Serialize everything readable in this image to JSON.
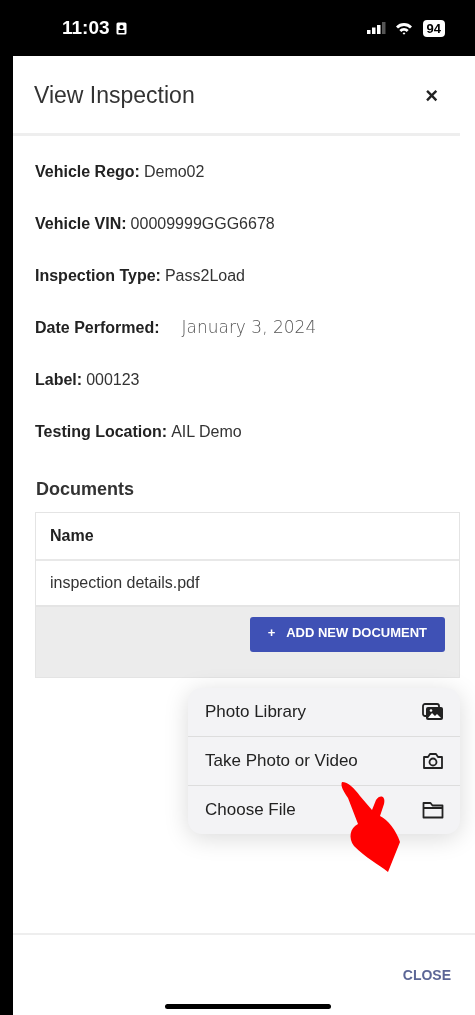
{
  "status_bar": {
    "time": "11:03",
    "battery": "94"
  },
  "dialog": {
    "title": "View Inspection",
    "close_glyph": "×"
  },
  "fields": [
    {
      "kind": "text",
      "label": "Vehicle Rego:",
      "value": "Demo02"
    },
    {
      "kind": "text",
      "label": "Vehicle VIN:",
      "value": "00009999GGG6678"
    },
    {
      "kind": "text",
      "label": "Inspection Type:",
      "value": "Pass2Load"
    },
    {
      "kind": "date",
      "label": "Date Performed:",
      "value": "January 3, 2024"
    },
    {
      "kind": "text",
      "label": "Label:",
      "value": "000123"
    },
    {
      "kind": "text",
      "label": "Testing Location:",
      "value": "AIL Demo"
    }
  ],
  "documents": {
    "title": "Documents",
    "column": "Name",
    "rows": [
      "inspection details.pdf"
    ],
    "add_button": {
      "icon": "+",
      "label": "ADD NEW DOCUMENT"
    }
  },
  "menu": [
    {
      "kind": "photos",
      "label": "Photo Library"
    },
    {
      "kind": "camera",
      "label": "Take Photo or Video"
    },
    {
      "kind": "folder",
      "label": "Choose File"
    }
  ],
  "footer": {
    "close": "CLOSE"
  }
}
